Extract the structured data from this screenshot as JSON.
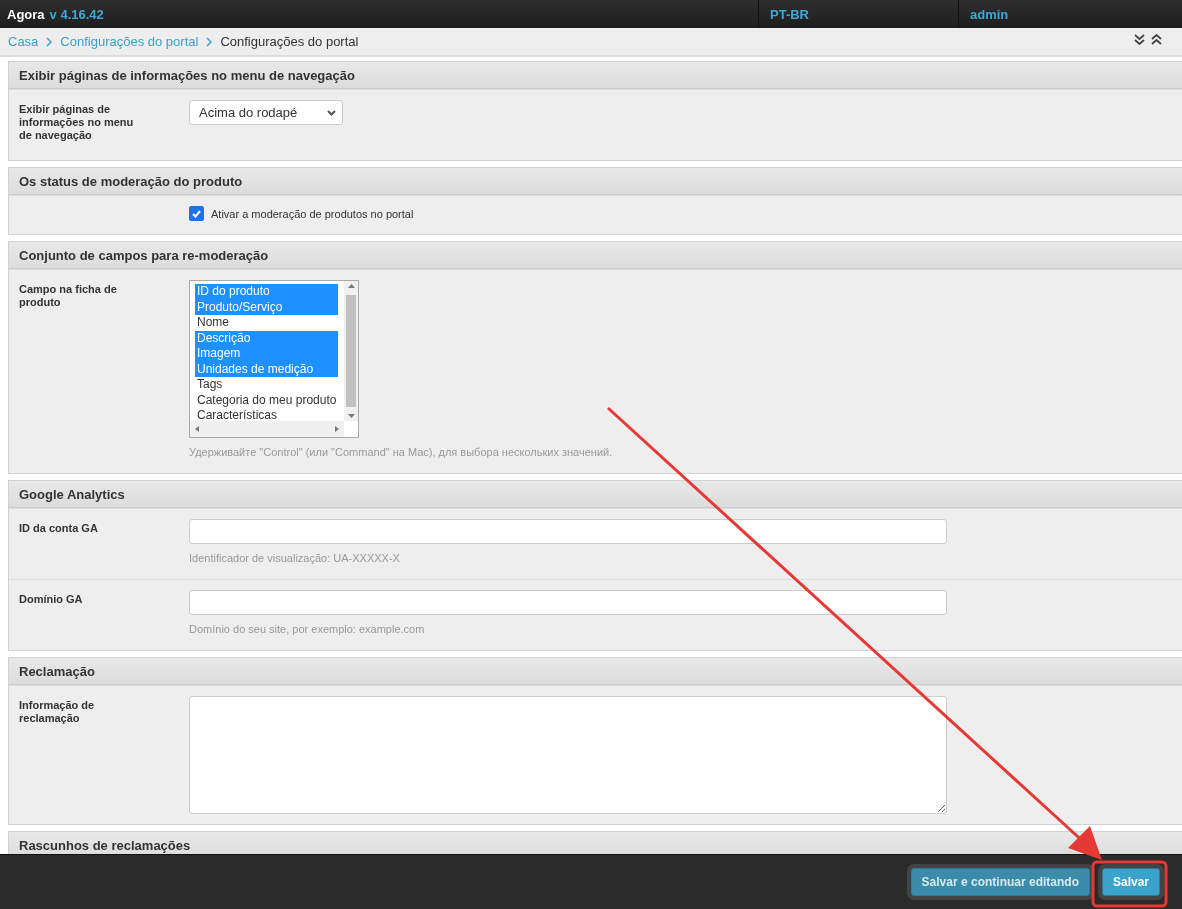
{
  "topbar": {
    "brand": "Agora",
    "version": "v 4.16.42",
    "language": "PT-BR",
    "user": "admin"
  },
  "breadcrumb": [
    {
      "label": "Casa",
      "link": true
    },
    {
      "label": "Configurações do portal",
      "link": true
    },
    {
      "label": "Configurações do portal",
      "link": false
    }
  ],
  "sections": [
    {
      "kind": "select",
      "title": "Exibir páginas de informações no menu de navegação",
      "label": "Exibir páginas de informações no menu de navegação",
      "value": "Acima do rodapé"
    },
    {
      "kind": "checkbox",
      "title": "Os status de moderação do produto",
      "label": "Ativar a moderação de produtos no portal",
      "checked": true
    },
    {
      "kind": "multiselect",
      "title": "Conjunto de campos para re-moderação",
      "label": "Campo na ficha de produto",
      "help": "Удерживайте \"Control\" (или \"Command\" на Mac), для выбора нескольких значений.",
      "options": [
        {
          "label": "ID do produto",
          "selected": true
        },
        {
          "label": "Produto/Serviço",
          "selected": true
        },
        {
          "label": "Nome",
          "selected": false
        },
        {
          "label": "Descrição",
          "selected": true
        },
        {
          "label": "Imagem",
          "selected": true
        },
        {
          "label": "Unidades de medição",
          "selected": true
        },
        {
          "label": "Tags",
          "selected": false
        },
        {
          "label": "Categoria do meu produto",
          "selected": false
        },
        {
          "label": "Características",
          "selected": false
        }
      ]
    },
    {
      "kind": "fields",
      "title": "Google Analytics",
      "fields": [
        {
          "label": "ID da conta GA",
          "help": "Identificador de visualização: UA-XXXXX-X"
        },
        {
          "label": "Domínio GA",
          "help": "Domínio do seu site, por exemplo: example.com"
        }
      ]
    },
    {
      "kind": "textarea",
      "title": "Reclamação",
      "label": "Informação de reclamação"
    },
    {
      "kind": "collapsed",
      "title": "Rascunhos de reclamações"
    }
  ],
  "footer": {
    "buttons": [
      {
        "label": "Salvar e continuar editando",
        "highlighted": false
      },
      {
        "label": "Salvar",
        "highlighted": true
      }
    ]
  }
}
